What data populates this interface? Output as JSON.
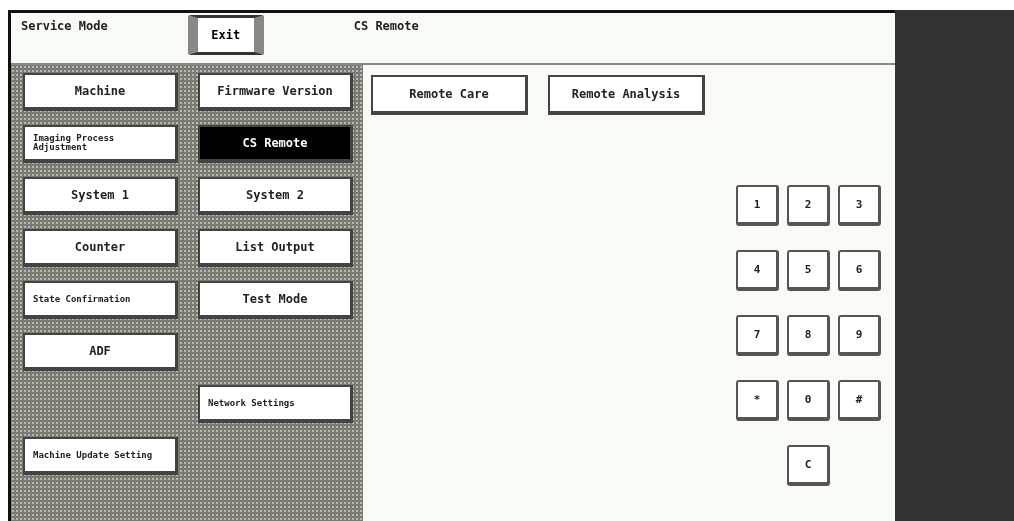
{
  "header": {
    "title": "Service Mode",
    "exit_button": "Exit",
    "screen_title": "CS Remote"
  },
  "menu": {
    "columns": [
      {
        "items": [
          {
            "kind": "button",
            "label": "Machine",
            "selected": false
          },
          {
            "kind": "small-button",
            "label": "Imaging Process Adjustment",
            "selected": false
          },
          {
            "kind": "button",
            "label": "System 1",
            "selected": false
          },
          {
            "kind": "button",
            "label": "Counter",
            "selected": false
          },
          {
            "kind": "small-button",
            "label": "State Confirmation",
            "selected": false
          },
          {
            "kind": "button",
            "label": "ADF",
            "selected": false
          },
          {
            "kind": "blank"
          },
          {
            "kind": "small-button",
            "label": "Machine Update Setting",
            "selected": false
          }
        ]
      },
      {
        "items": [
          {
            "kind": "button",
            "label": "Firmware Version",
            "selected": false
          },
          {
            "kind": "button",
            "label": "CS Remote",
            "selected": true
          },
          {
            "kind": "button",
            "label": "System 2",
            "selected": false
          },
          {
            "kind": "button",
            "label": "List Output",
            "selected": false
          },
          {
            "kind": "button",
            "label": "Test Mode",
            "selected": false
          },
          {
            "kind": "blank"
          },
          {
            "kind": "small-button",
            "label": "Network Settings",
            "selected": false
          },
          {
            "kind": "blank"
          }
        ]
      }
    ]
  },
  "content": {
    "buttons": [
      "Remote Care",
      "Remote Analysis"
    ]
  },
  "keypad": {
    "keys": [
      "1",
      "2",
      "3",
      "4",
      "5",
      "6",
      "7",
      "8",
      "9",
      "*",
      "0",
      "#"
    ],
    "clear": "C"
  }
}
